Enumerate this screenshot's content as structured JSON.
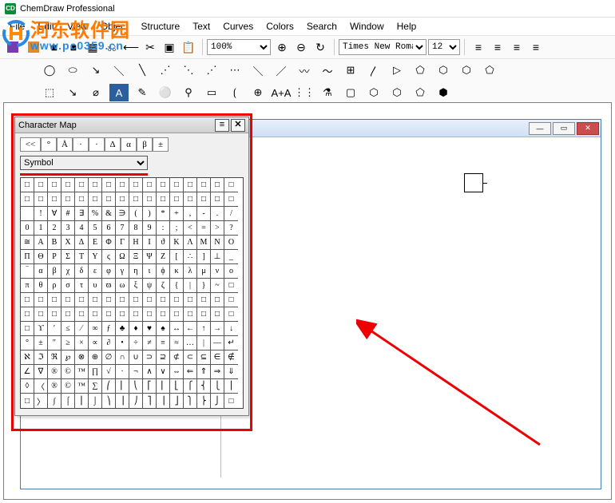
{
  "title": "ChemDraw Professional",
  "app_icon_letter": "CD",
  "menus": [
    "File",
    "Edit",
    "View",
    "Object",
    "Structure",
    "Text",
    "Curves",
    "Colors",
    "Search",
    "Window",
    "Help"
  ],
  "toolbar": {
    "zoom": "100%",
    "font": "Times New Roman",
    "size": "12"
  },
  "tool_icons_row1": [
    "■",
    "■",
    "▦",
    "⎌",
    "⟵",
    "✂",
    "▣",
    "📋"
  ],
  "zoom_icons": [
    "⊕",
    "⊖",
    "↻"
  ],
  "align_icons": [
    "≡",
    "≡",
    "≡",
    "≡"
  ],
  "tool_row2": [
    "◯",
    "⬭",
    "↘",
    "＼",
    "╲",
    "⋰",
    "⋱",
    "⋰",
    "⋯",
    "＼",
    "／",
    "〰",
    "〜",
    "⊞",
    "〳",
    "▷",
    "⬠",
    "⬡",
    "⬡",
    "⬠"
  ],
  "tool_row3": [
    "⬚",
    "↘",
    "⌀",
    "A",
    "✎",
    "⚪",
    "⚲",
    "▭",
    "⟮",
    "⊕",
    "A+A",
    "⋮⋮",
    "⚗",
    "▢",
    "⬡",
    "⬡",
    "⬠",
    "⬢"
  ],
  "charmap": {
    "title": "Character Map",
    "recent": [
      "<<",
      "°",
      "Å",
      "·",
      "·",
      "Δ",
      "α",
      "β",
      "±"
    ],
    "font": "Symbol",
    "grid": [
      [
        "□",
        "□",
        "□",
        "□",
        "□",
        "□",
        "□",
        "□",
        "□",
        "□",
        "□",
        "□",
        "□",
        "□",
        "□",
        "□"
      ],
      [
        "□",
        "□",
        "□",
        "□",
        "□",
        "□",
        "□",
        "□",
        "□",
        "□",
        "□",
        "□",
        "□",
        "□",
        "□",
        "□"
      ],
      [
        " ",
        "!",
        "∀",
        "#",
        "∃",
        "%",
        "&",
        "∋",
        "(",
        ")",
        "*",
        "+",
        ",",
        "-",
        ".",
        "/"
      ],
      [
        "0",
        "1",
        "2",
        "3",
        "4",
        "5",
        "6",
        "7",
        "8",
        "9",
        ":",
        ";",
        "<",
        "=",
        ">",
        "?"
      ],
      [
        "≅",
        "Α",
        "Β",
        "Χ",
        "Δ",
        "Ε",
        "Φ",
        "Γ",
        "Η",
        "Ι",
        "ϑ",
        "Κ",
        "Λ",
        "Μ",
        "Ν",
        "Ο"
      ],
      [
        "Π",
        "Θ",
        "Ρ",
        "Σ",
        "Τ",
        "Υ",
        "ς",
        "Ω",
        "Ξ",
        "Ψ",
        "Ζ",
        "[",
        "∴",
        "]",
        "⊥",
        "_"
      ],
      [
        "‾",
        "α",
        "β",
        "χ",
        "δ",
        "ε",
        "φ",
        "γ",
        "η",
        "ι",
        "ϕ",
        "κ",
        "λ",
        "μ",
        "ν",
        "ο"
      ],
      [
        "π",
        "θ",
        "ρ",
        "σ",
        "τ",
        "υ",
        "ϖ",
        "ω",
        "ξ",
        "ψ",
        "ζ",
        "{",
        "|",
        "}",
        "~",
        "□"
      ],
      [
        "□",
        "□",
        "□",
        "□",
        "□",
        "□",
        "□",
        "□",
        "□",
        "□",
        "□",
        "□",
        "□",
        "□",
        "□",
        "□"
      ],
      [
        "□",
        "□",
        "□",
        "□",
        "□",
        "□",
        "□",
        "□",
        "□",
        "□",
        "□",
        "□",
        "□",
        "□",
        "□",
        "□"
      ],
      [
        "□",
        "ϒ",
        "′",
        "≤",
        "⁄",
        "∞",
        "ƒ",
        "♣",
        "♦",
        "♥",
        "♠",
        "↔",
        "←",
        "↑",
        "→",
        "↓"
      ],
      [
        "°",
        "±",
        "″",
        "≥",
        "×",
        "∝",
        "∂",
        "•",
        "÷",
        "≠",
        "≡",
        "≈",
        "…",
        "|",
        "—",
        "↵"
      ],
      [
        "ℵ",
        "ℑ",
        "ℜ",
        "℘",
        "⊗",
        "⊕",
        "∅",
        "∩",
        "∪",
        "⊃",
        "⊇",
        "⊄",
        "⊂",
        "⊆",
        "∈",
        "∉"
      ],
      [
        "∠",
        "∇",
        "®",
        "©",
        "™",
        "∏",
        "√",
        "·",
        "¬",
        "∧",
        "∨",
        "⇔",
        "⇐",
        "⇑",
        "⇒",
        "⇓"
      ],
      [
        "◊",
        "〈",
        "®",
        "©",
        "™",
        "∑",
        "⎛",
        "⎜",
        "⎝",
        "⎡",
        "⎢",
        "⎣",
        "⎧",
        "⎨",
        "⎩",
        "⎪"
      ],
      [
        "□",
        "〉",
        "∫",
        "⌠",
        "⎮",
        "⌡",
        "⎞",
        "⎟",
        "⎠",
        "⎤",
        "⎥",
        "⎦",
        "⎫",
        "⎬",
        "⎭",
        "□"
      ]
    ]
  },
  "watermark": {
    "line1": "河东软件园",
    "line2": "www.pc0359.cn"
  }
}
